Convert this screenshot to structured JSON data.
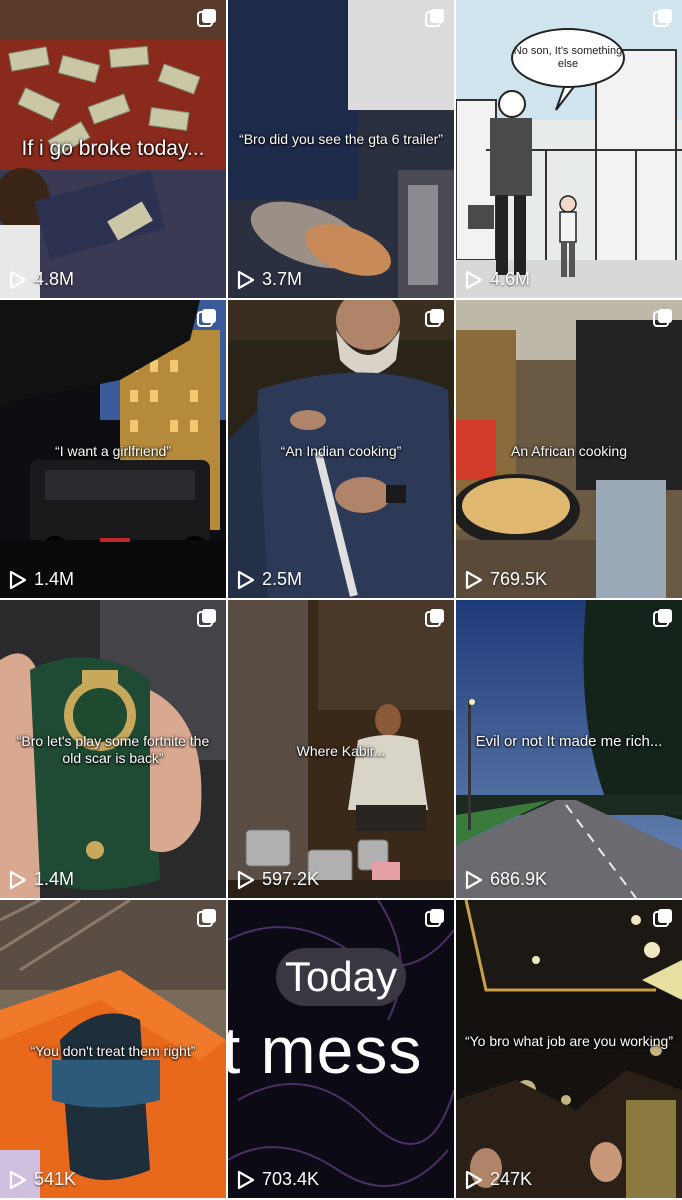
{
  "tiles": [
    {
      "caption": "If i go broke today...",
      "views": "4.8M"
    },
    {
      "caption": "“Bro did you see the gta 6 trailer”",
      "views": "3.7M"
    },
    {
      "caption": "No son, It's something else",
      "views": "4.6M"
    },
    {
      "caption": "“I want a girlfriend”",
      "views": "1.4M"
    },
    {
      "caption": "“An Indian cooking”",
      "views": "2.5M"
    },
    {
      "caption": "An African cooking",
      "views": "769.5K"
    },
    {
      "caption": "“Bro let's play some fortnite the old scar is back”",
      "views": "1.4M"
    },
    {
      "caption": "Where Kabir...",
      "views": "597.2K"
    },
    {
      "caption": "Evil or not It made me rich...",
      "views": "686.9K"
    },
    {
      "caption": "“You don't treat them right”",
      "views": "541K"
    },
    {
      "caption": "",
      "overlay_big": "Today",
      "overlay_word": "t mess",
      "views": "703.4K"
    },
    {
      "caption": "“Yo bro what job are you working”",
      "views": "247K"
    }
  ],
  "icons": {
    "views": "play-icon",
    "multi": "carousel-icon"
  }
}
